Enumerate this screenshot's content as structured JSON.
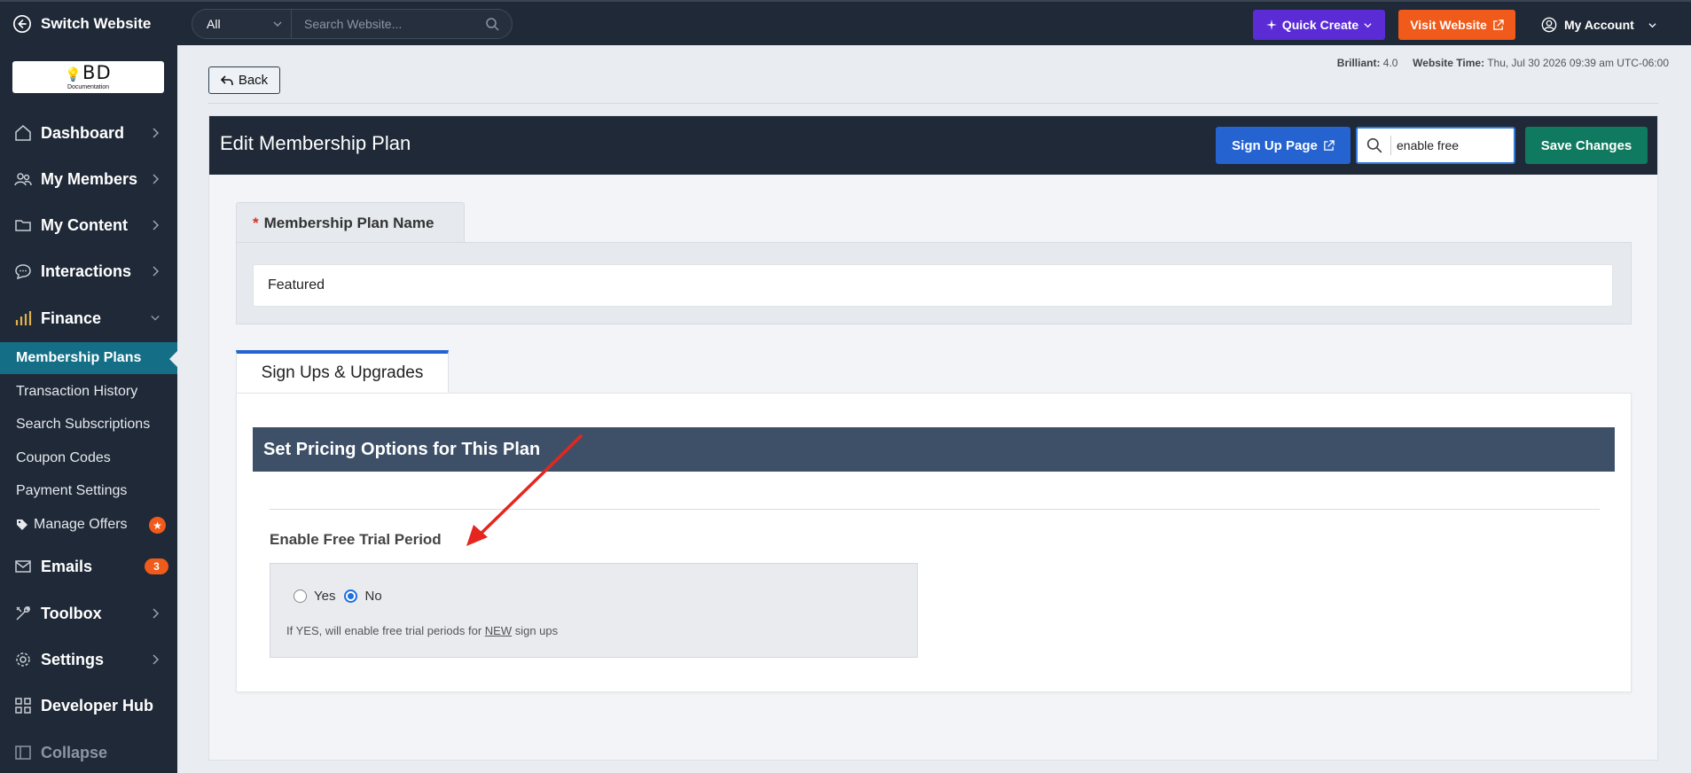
{
  "topbar": {
    "switch_label": "Switch Website",
    "search_scope": "All",
    "search_placeholder": "Search Website...",
    "quick_create": "Quick Create",
    "visit_website": "Visit Website",
    "my_account": "My Account"
  },
  "sidebar": {
    "logo_text": "BD",
    "logo_sub": "Documentation",
    "nav": [
      {
        "label": "Dashboard",
        "icon": "house-icon"
      },
      {
        "label": "My Members",
        "icon": "users-icon"
      },
      {
        "label": "My Content",
        "icon": "folder-icon"
      },
      {
        "label": "Interactions",
        "icon": "chat-icon"
      },
      {
        "label": "Finance",
        "icon": "bar-chart-icon"
      }
    ],
    "finance_sub": [
      {
        "label": "Membership Plans"
      },
      {
        "label": "Transaction History"
      },
      {
        "label": "Search Subscriptions"
      },
      {
        "label": "Coupon Codes"
      },
      {
        "label": "Payment Settings"
      },
      {
        "label": "Manage Offers"
      }
    ],
    "nav2": [
      {
        "label": "Emails",
        "icon": "mail-icon",
        "badge": "3"
      },
      {
        "label": "Toolbox",
        "icon": "tools-icon"
      },
      {
        "label": "Settings",
        "icon": "gear-icon"
      },
      {
        "label": "Developer Hub",
        "icon": "grid-icon"
      },
      {
        "label": "Collapse",
        "icon": "sidebar-icon"
      }
    ],
    "active_color": "#146f86",
    "badge_color": "#f05a1a"
  },
  "main": {
    "back_label": "Back",
    "meta_version_label": "Brilliant:",
    "meta_version": "4.0",
    "meta_time_label": "Website Time:",
    "meta_time": "Thu, Jul 30 2026 09:39 am UTC-06:00",
    "title": "Edit Membership Plan",
    "signup_page": "Sign Up Page",
    "header_search_value": "enable free",
    "save_changes": "Save Changes",
    "plan_name_label": "Membership Plan Name",
    "plan_name_required": "*",
    "plan_name_value": "Featured",
    "tab_label": "Sign Ups & Upgrades",
    "section_title": "Set Pricing Options for This Plan",
    "free_trial_label": "Enable Free Trial Period",
    "opt_yes": "Yes",
    "opt_no": "No",
    "selected": "No",
    "help_pre": "If YES, will enable free trial periods for ",
    "help_emph": "NEW",
    "help_post": " sign ups"
  },
  "colors": {
    "topbar": "#1f2937",
    "quick_create": "#5b2bd6",
    "visit_website": "#f05a1a",
    "signup_button": "#2563d1",
    "save_button": "#0f7a5f",
    "section_bar": "#3e5068",
    "annotation_arrow": "#e5261f"
  }
}
